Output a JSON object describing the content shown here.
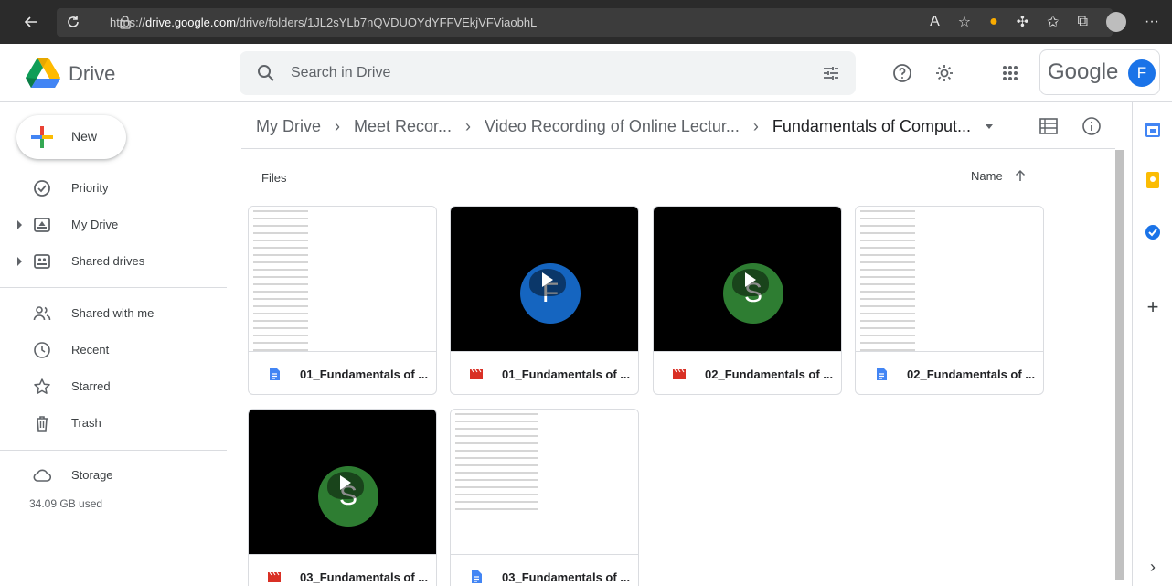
{
  "browser": {
    "url_prefix": "https://",
    "url_host": "drive.google.com",
    "url_path": "/drive/folders/1JL2sYLb7nQVDUOYdYFFVEkjVFViaobhL"
  },
  "header": {
    "app_name": "Drive",
    "search_placeholder": "Search in Drive",
    "google_word": "Google",
    "account_initial": "F"
  },
  "sidebar": {
    "new_label": "New",
    "items": [
      {
        "label": "Priority"
      },
      {
        "label": "My Drive"
      },
      {
        "label": "Shared drives"
      },
      {
        "label": "Shared with me"
      },
      {
        "label": "Recent"
      },
      {
        "label": "Starred"
      },
      {
        "label": "Trash"
      },
      {
        "label": "Storage"
      }
    ],
    "storage_used": "34.09 GB used"
  },
  "breadcrumb": {
    "items": [
      "My Drive",
      "Meet Recor...",
      "Video Recording of Online Lectur...",
      "Fundamentals of Comput..."
    ]
  },
  "main": {
    "section_label": "Files",
    "sort_label": "Name",
    "files": [
      {
        "name": "01_Fundamentals of ...",
        "kind": "doc"
      },
      {
        "name": "01_Fundamentals of ...",
        "kind": "video",
        "initial": "F",
        "color": "#1565c0"
      },
      {
        "name": "02_Fundamentals of ...",
        "kind": "video",
        "initial": "S",
        "color": "#2e7d32"
      },
      {
        "name": "02_Fundamentals of ...",
        "kind": "doc"
      },
      {
        "name": "03_Fundamentals of ...",
        "kind": "video",
        "initial": "S",
        "color": "#2e7d32"
      },
      {
        "name": "03_Fundamentals of ...",
        "kind": "doc"
      }
    ]
  },
  "colors": {
    "doc_blue": "#4285f4",
    "video_red": "#d93025"
  }
}
